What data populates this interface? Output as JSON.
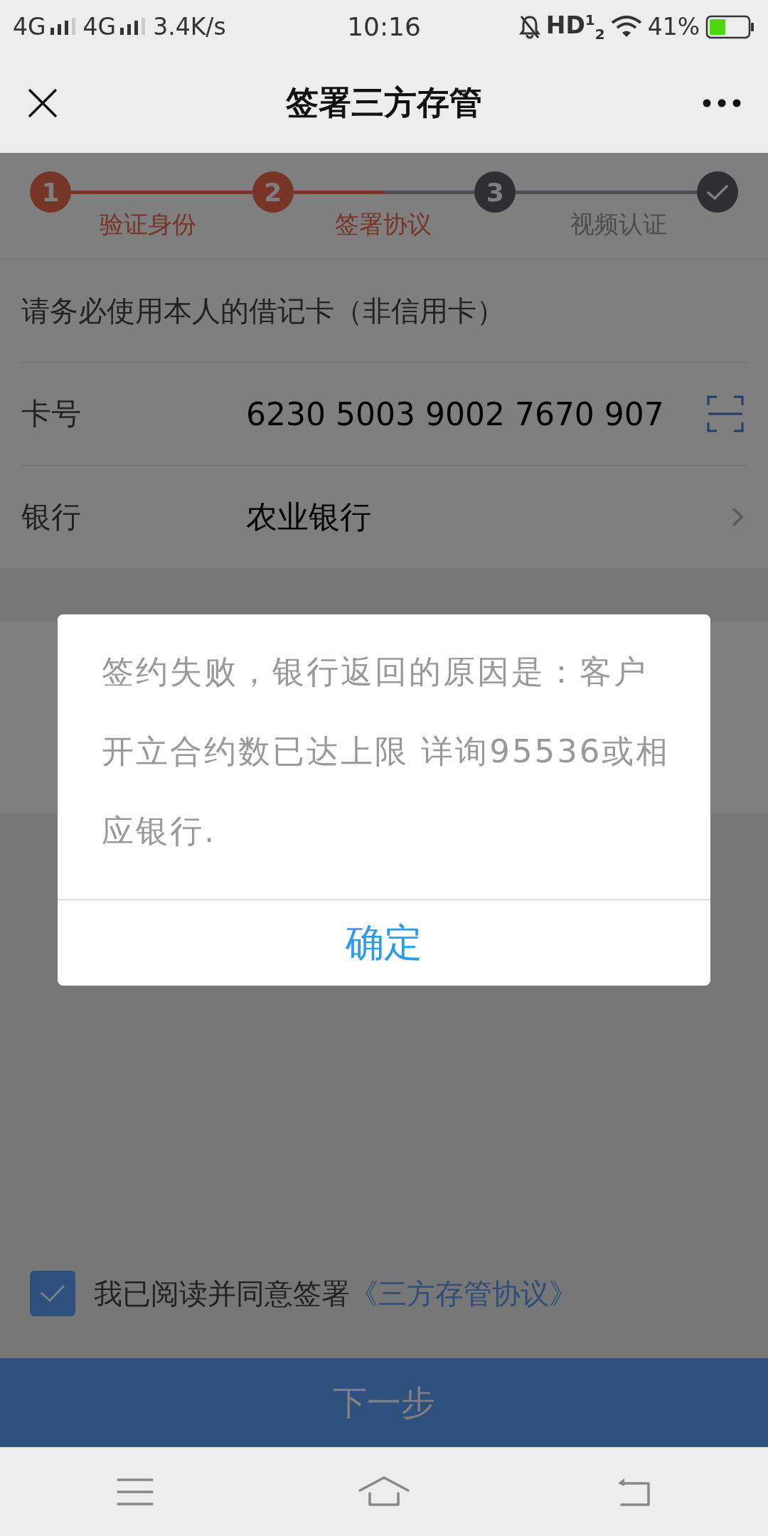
{
  "status_bar": {
    "signal_1": "4G",
    "signal_2": "4G",
    "speed": "3.4K/s",
    "time": "10:16",
    "hd": "HD$^{1}$$_{2}$",
    "battery": "41%"
  },
  "nav": {
    "title": "签署三方存管"
  },
  "steps": [
    {
      "kind": "number",
      "number": "1",
      "label": "验证身份",
      "reached": true
    },
    {
      "kind": "number",
      "number": "2",
      "label": "签署协议",
      "reached": true
    },
    {
      "kind": "number",
      "number": "3",
      "label": "视频认证",
      "reached": false
    },
    {
      "kind": "check",
      "reached": false
    }
  ],
  "notice": "请务必使用本人的借记卡（非信用卡）",
  "fields": [
    {
      "kind": "scan",
      "label": "卡号",
      "value": "6230 5003 9002 7670 907"
    },
    {
      "kind": "select",
      "label": "银行",
      "value": "农业银行"
    }
  ],
  "agreement": {
    "checked": true,
    "text": "我已阅读并同意签署",
    "link": "《三方存管协议》"
  },
  "next_button": "下一步",
  "dialog": {
    "message": "签约失败，银行返回的原因是：客户开立合约数已达上限 详询95536或相应银行.",
    "button": "确定"
  }
}
